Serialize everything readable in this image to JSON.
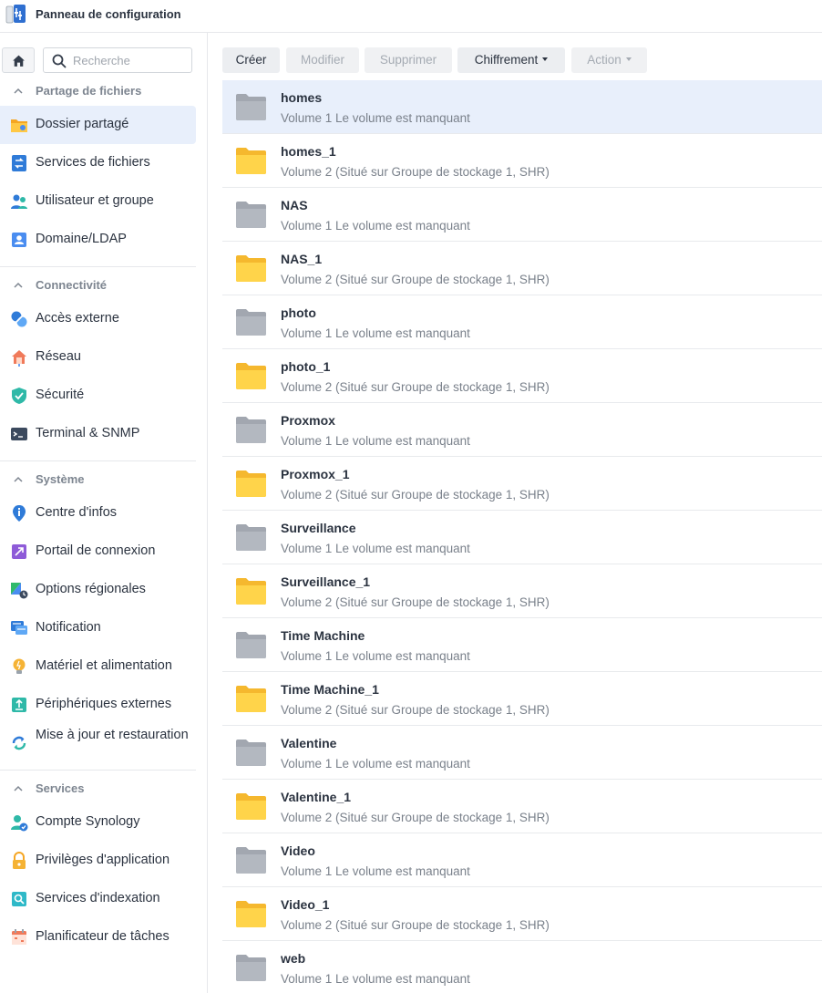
{
  "window": {
    "title": "Panneau de configuration"
  },
  "search": {
    "placeholder": "Recherche"
  },
  "sidebar": {
    "sections": [
      {
        "label": "Partage de fichiers",
        "items": [
          {
            "label": "Dossier partagé",
            "icon": "shared-folder-icon",
            "active": true
          },
          {
            "label": "Services de fichiers",
            "icon": "file-services-icon"
          },
          {
            "label": "Utilisateur et groupe",
            "icon": "user-group-icon"
          },
          {
            "label": "Domaine/LDAP",
            "icon": "domain-ldap-icon"
          }
        ]
      },
      {
        "label": "Connectivité",
        "items": [
          {
            "label": "Accès externe",
            "icon": "external-access-icon"
          },
          {
            "label": "Réseau",
            "icon": "network-icon"
          },
          {
            "label": "Sécurité",
            "icon": "security-shield-icon"
          },
          {
            "label": "Terminal & SNMP",
            "icon": "terminal-icon"
          }
        ]
      },
      {
        "label": "Système",
        "items": [
          {
            "label": "Centre d'infos",
            "icon": "info-center-icon"
          },
          {
            "label": "Portail de connexion",
            "icon": "login-portal-icon"
          },
          {
            "label": "Options régionales",
            "icon": "regional-options-icon"
          },
          {
            "label": "Notification",
            "icon": "notification-icon"
          },
          {
            "label": "Matériel et alimentation",
            "icon": "hardware-power-icon"
          },
          {
            "label": "Périphériques externes",
            "icon": "external-devices-icon"
          },
          {
            "label": "Mise à jour et restauration",
            "icon": "update-restore-icon"
          }
        ]
      },
      {
        "label": "Services",
        "items": [
          {
            "label": "Compte Synology",
            "icon": "synology-account-icon"
          },
          {
            "label": "Privilèges d'application",
            "icon": "app-privileges-icon"
          },
          {
            "label": "Services d'indexation",
            "icon": "indexing-service-icon"
          },
          {
            "label": "Planificateur de tâches",
            "icon": "task-scheduler-icon"
          }
        ]
      }
    ]
  },
  "toolbar": {
    "create": "Créer",
    "edit": "Modifier",
    "delete": "Supprimer",
    "encryption": "Chiffrement",
    "action": "Action"
  },
  "folders": [
    {
      "name": "homes",
      "desc": "Volume 1 Le volume est manquant",
      "missing": true
    },
    {
      "name": "homes_1",
      "desc": "Volume 2 (Situé sur Groupe de stockage 1, SHR)",
      "missing": false
    },
    {
      "name": "NAS",
      "desc": "Volume 1 Le volume est manquant",
      "missing": true
    },
    {
      "name": "NAS_1",
      "desc": "Volume 2 (Situé sur Groupe de stockage 1, SHR)",
      "missing": false
    },
    {
      "name": "photo",
      "desc": "Volume 1 Le volume est manquant",
      "missing": true
    },
    {
      "name": "photo_1",
      "desc": "Volume 2 (Situé sur Groupe de stockage 1, SHR)",
      "missing": false
    },
    {
      "name": "Proxmox",
      "desc": "Volume 1 Le volume est manquant",
      "missing": true
    },
    {
      "name": "Proxmox_1",
      "desc": "Volume 2 (Situé sur Groupe de stockage 1, SHR)",
      "missing": false
    },
    {
      "name": "Surveillance",
      "desc": "Volume 1 Le volume est manquant",
      "missing": true
    },
    {
      "name": "Surveillance_1",
      "desc": "Volume 2 (Situé sur Groupe de stockage 1, SHR)",
      "missing": false
    },
    {
      "name": "Time Machine",
      "desc": "Volume 1 Le volume est manquant",
      "missing": true
    },
    {
      "name": "Time Machine_1",
      "desc": "Volume 2 (Situé sur Groupe de stockage 1, SHR)",
      "missing": false
    },
    {
      "name": "Valentine",
      "desc": "Volume 1 Le volume est manquant",
      "missing": true
    },
    {
      "name": "Valentine_1",
      "desc": "Volume 2 (Situé sur Groupe de stockage 1, SHR)",
      "missing": false
    },
    {
      "name": "Video",
      "desc": "Volume 1 Le volume est manquant",
      "missing": true
    },
    {
      "name": "Video_1",
      "desc": "Volume 2 (Situé sur Groupe de stockage 1, SHR)",
      "missing": false
    },
    {
      "name": "web",
      "desc": "Volume 1 Le volume est manquant",
      "missing": true
    }
  ],
  "colors": {
    "accent": "#2f7bd8",
    "selected_bg": "#e8effb",
    "folder_yellow": "#ffd44a",
    "folder_grey": "#b3b8c0"
  }
}
